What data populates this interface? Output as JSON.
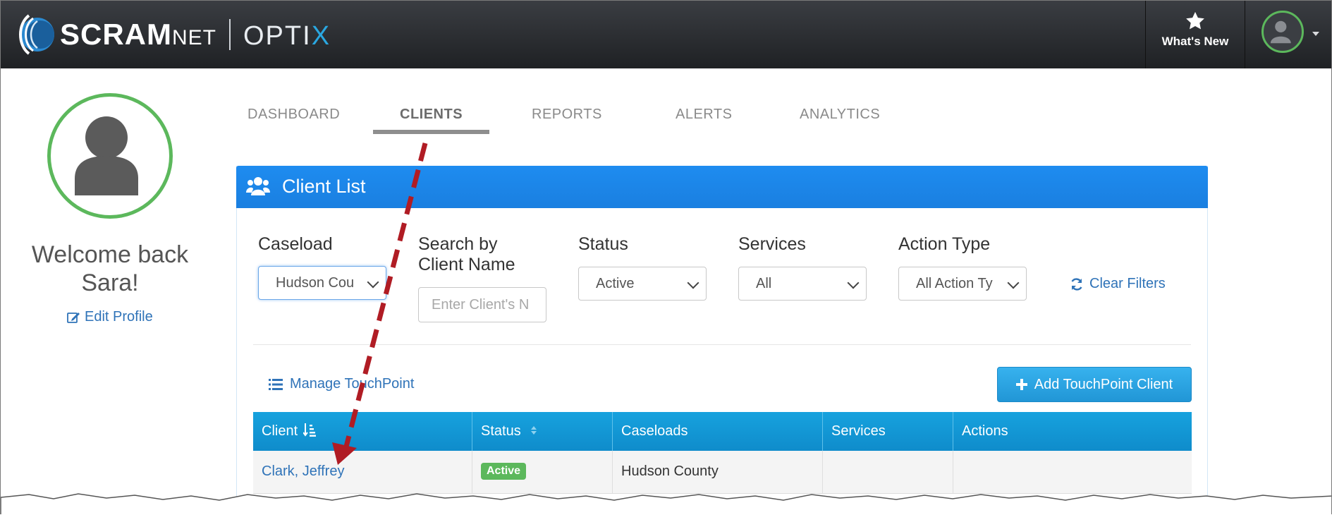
{
  "brand": {
    "name": "SCRAM",
    "suffix": "NET",
    "product_main": "OPTI",
    "product_x": "X"
  },
  "header": {
    "whats_new_label": "What's New"
  },
  "profile": {
    "welcome_line1": "Welcome back",
    "welcome_line2": "Sara!",
    "edit_label": "Edit Profile"
  },
  "tabs": [
    {
      "label": "DASHBOARD",
      "active": false
    },
    {
      "label": "CLIENTS",
      "active": true
    },
    {
      "label": "REPORTS",
      "active": false
    },
    {
      "label": "ALERTS",
      "active": false
    },
    {
      "label": "ANALYTICS",
      "active": false
    }
  ],
  "panel": {
    "title": "Client List"
  },
  "filters": {
    "caseload": {
      "label": "Caseload",
      "value": "Hudson Cou"
    },
    "search": {
      "label_line1": "Search by",
      "label_line2": "Client Name",
      "placeholder": "Enter Client's N"
    },
    "status": {
      "label": "Status",
      "value": "Active"
    },
    "services": {
      "label": "Services",
      "value": "All"
    },
    "action_type": {
      "label": "Action Type",
      "value": "All Action Ty"
    },
    "clear_label": "Clear Filters"
  },
  "actions": {
    "manage_label": "Manage TouchPoint",
    "add_label": "Add TouchPoint Client"
  },
  "table": {
    "headers": [
      "Client",
      "Status",
      "Caseloads",
      "Services",
      "Actions"
    ],
    "rows": [
      {
        "client": "Clark, Jeffrey",
        "status": "Active",
        "caseloads": "Hudson County",
        "services": "",
        "actions": ""
      }
    ]
  },
  "colors": {
    "accent_blue": "#1e8cf0",
    "table_header": "#17a2de",
    "status_green": "#5cb85c",
    "annotation_arrow": "#b01c24"
  },
  "annotations": {
    "arrow_icon": "dashed-arrow"
  }
}
